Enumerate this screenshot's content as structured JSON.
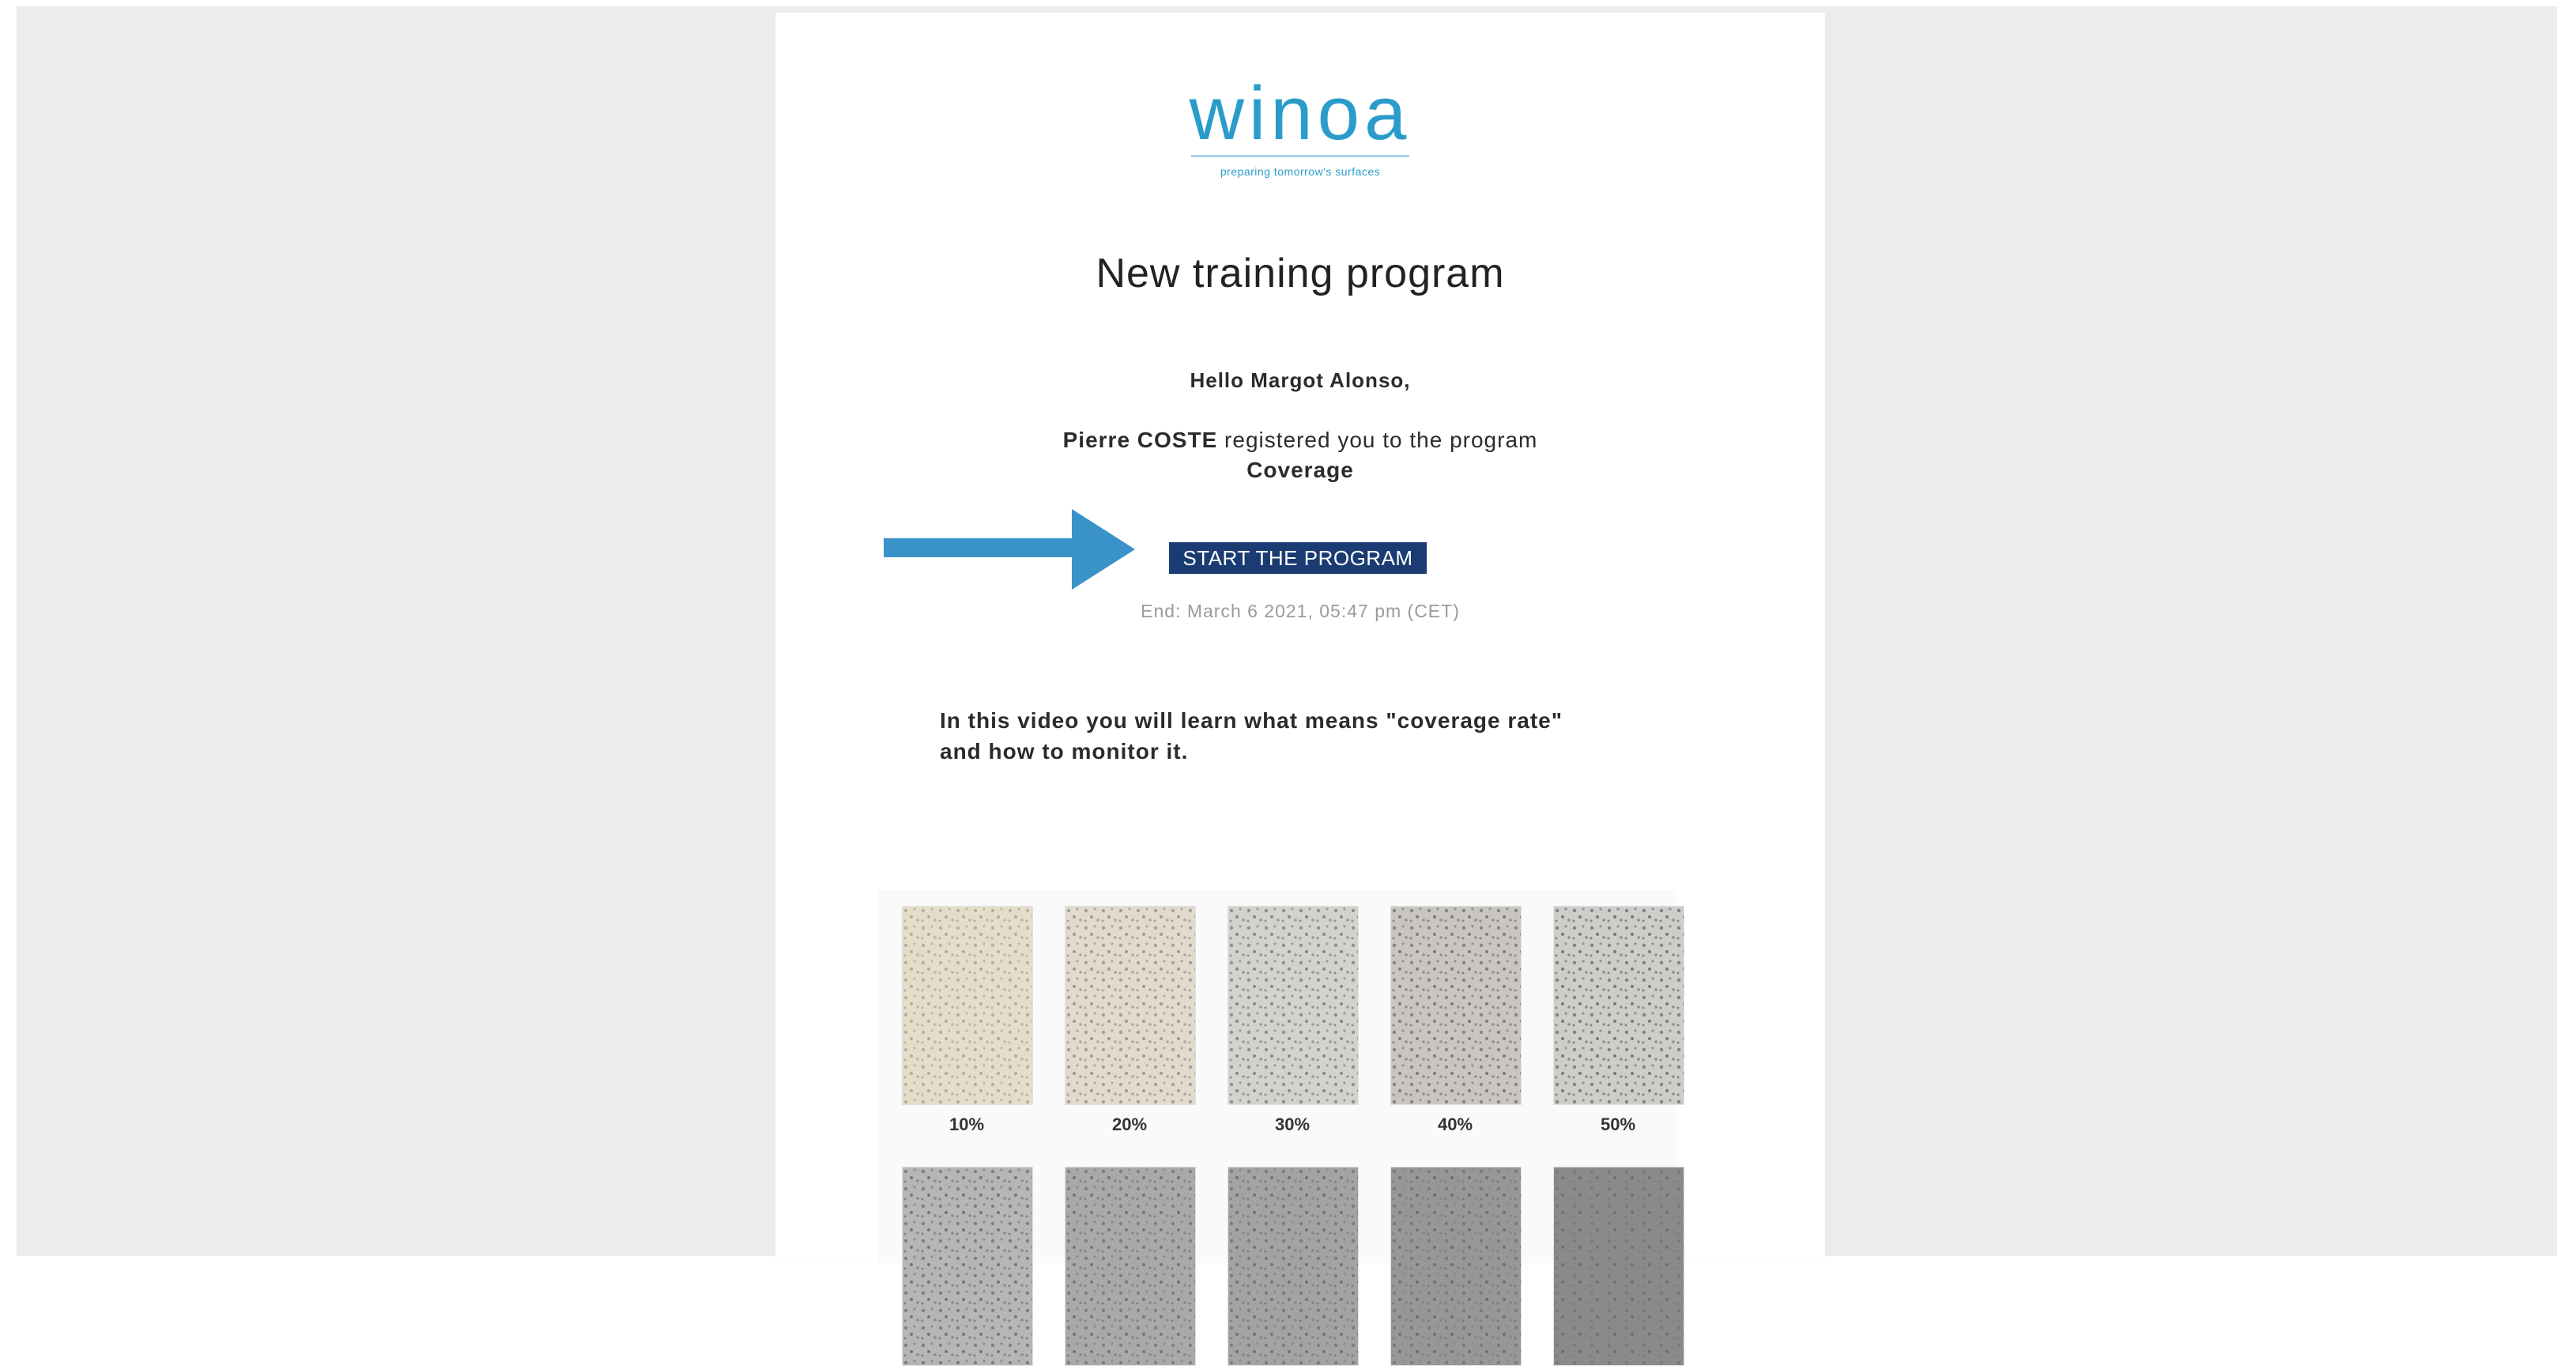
{
  "logo": {
    "wordmark": "winoa",
    "tagline": "preparing tomorrow's surfaces"
  },
  "email": {
    "title": "New training program",
    "greeting": "Hello Margot Alonso,",
    "registrar": "Pierre COSTE",
    "registration_text": " registered you to the program",
    "program_name": "Coverage",
    "start_button": "START THE PROGRAM",
    "end_date": "End: March 6 2021, 05:47 pm (CET)",
    "intro_line1": "In this video you will learn what means \"coverage rate\"",
    "intro_line2": "and how to monitor it."
  },
  "coverage_samples": {
    "row1": [
      "10%",
      "20%",
      "30%",
      "40%",
      "50%"
    ]
  },
  "colors": {
    "page_background": "#ececec",
    "brand": "#2a9cc9",
    "button": "#1b3c73",
    "arrow": "#3a93c8"
  }
}
